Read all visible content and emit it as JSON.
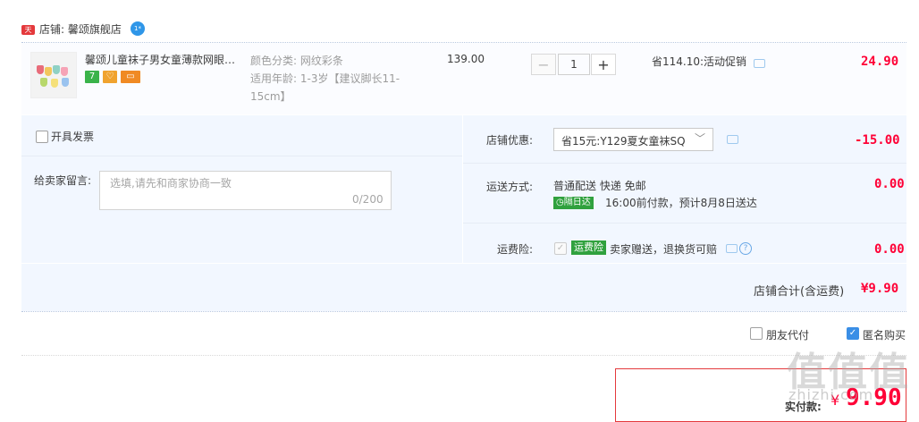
{
  "shop": {
    "badge": "天猫",
    "label": "店铺: 馨颂旗舰店",
    "ww_badge": "1*"
  },
  "item": {
    "title": "馨颂儿童袜子男女童薄款网眼袜...",
    "service_tags": [
      "7",
      "♡",
      "▭"
    ],
    "attr_color_label": "颜色分类:",
    "attr_color_value": "网纹彩条",
    "attr_age_label": "适用年龄:",
    "attr_age_value_line1": "1-3岁【建议脚长11-",
    "attr_age_value_line2": "15cm】",
    "unit_price": "139.00",
    "qty_minus": "−",
    "quantity": "1",
    "qty_plus": "+",
    "promo": "省114.10:活动促销",
    "subtotal": "24.90"
  },
  "invoice": {
    "label": "开具发票"
  },
  "remark": {
    "label": "给卖家留言:",
    "placeholder": "选填,请先和商家协商一致",
    "count": "0/200"
  },
  "shop_discount": {
    "label": "店铺优惠:",
    "selected": "省15元:Y129夏女童袜SQ",
    "amount": "-15.00"
  },
  "shipping": {
    "label": "运送方式:",
    "method": "普通配送 快递 免邮",
    "tag": "隔日达",
    "eta": "16:00前付款，预计8月8日送达",
    "amount": "0.00"
  },
  "freight_insurance": {
    "label": "运费险:",
    "tag": "运费险",
    "desc": "卖家赠送，退换货可赔",
    "help": "?",
    "amount": "0.00"
  },
  "summary": {
    "label": "店铺合计(含运费)",
    "amount": "¥9.90"
  },
  "options": {
    "friend_pay": "朋友代付",
    "anonymous": "匿名购买"
  },
  "payment": {
    "label": "实付款:",
    "currency": "¥",
    "amount": "9.90"
  },
  "watermark": {
    "logo": "值值值",
    "url": "zhizhi.com"
  },
  "colors": {
    "accent_red": "#ff0036",
    "panel_bg": "#f2f7ff",
    "check_blue": "#3a8ee6",
    "tag_green": "#30a13e"
  }
}
